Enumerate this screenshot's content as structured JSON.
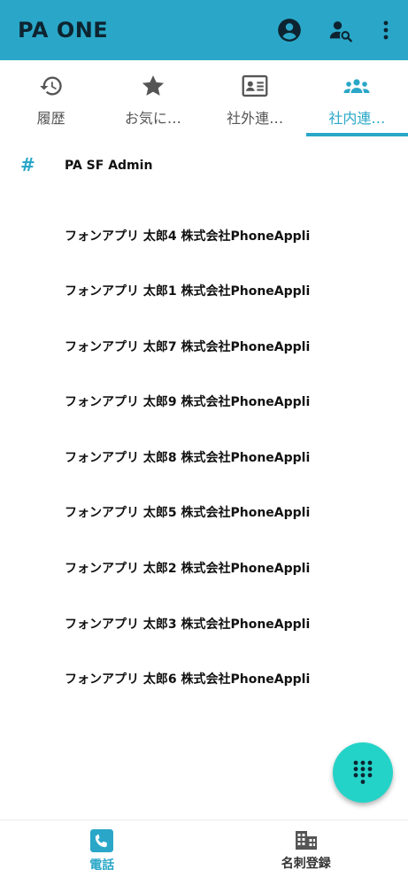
{
  "appbar": {
    "title": "PA ONE",
    "icons": [
      "account-circle-icon",
      "person-search-icon",
      "more-vert-icon"
    ]
  },
  "tabs": [
    {
      "label": "履歴",
      "icon": "history-icon",
      "active": false
    },
    {
      "label": "お気に…",
      "icon": "star-icon",
      "active": false
    },
    {
      "label": "社外連…",
      "icon": "contact-card-icon",
      "active": false
    },
    {
      "label": "社内連…",
      "icon": "group-icon",
      "active": true
    }
  ],
  "contacts": {
    "section_symbol": "#",
    "items": [
      "PA SF Admin",
      "フォンアプリ 太郎4 株式会社PhoneAppli",
      "フォンアプリ 太郎1 株式会社PhoneAppli",
      "フォンアプリ 太郎7 株式会社PhoneAppli",
      "フォンアプリ 太郎9 株式会社PhoneAppli",
      "フォンアプリ 太郎8 株式会社PhoneAppli",
      "フォンアプリ 太郎5 株式会社PhoneAppli",
      "フォンアプリ 太郎2 株式会社PhoneAppli",
      "フォンアプリ 太郎3 株式会社PhoneAppli",
      "フォンアプリ 太郎6 株式会社PhoneAppli"
    ]
  },
  "fab": {
    "icon": "dialpad-icon"
  },
  "bottom_nav": [
    {
      "label": "電話",
      "icon": "phone-icon",
      "active": true
    },
    {
      "label": "名刺登録",
      "icon": "business-icon",
      "active": false
    }
  ],
  "colors": {
    "accent": "#2aa7c8",
    "fab": "#24d3c8",
    "title_text": "#0d2430"
  }
}
